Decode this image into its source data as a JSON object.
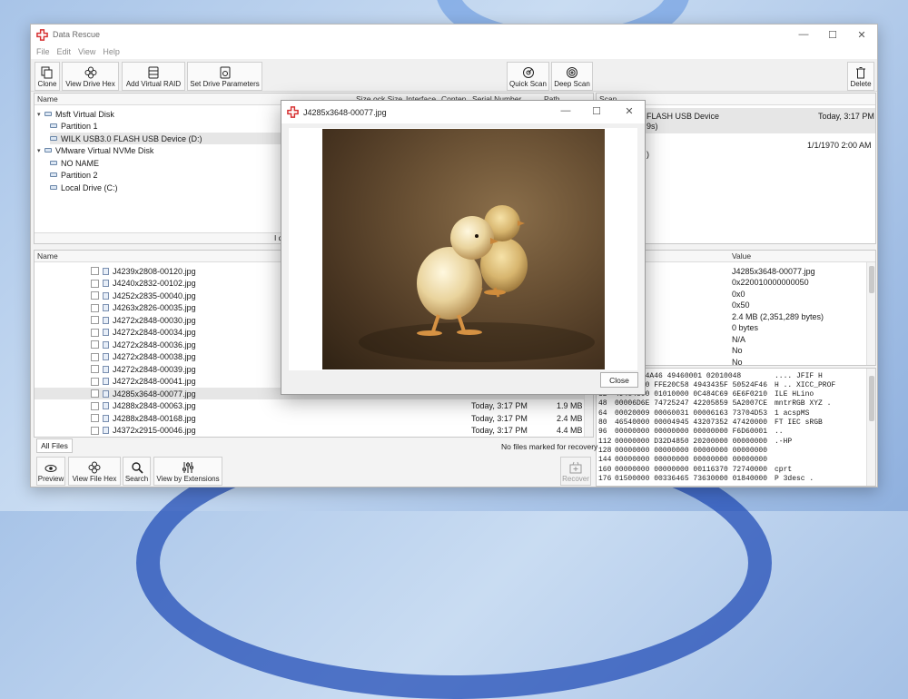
{
  "app": {
    "title": "Data Rescue"
  },
  "menu": [
    "File",
    "Edit",
    "View",
    "Help"
  ],
  "toolbar": {
    "clone": "Clone",
    "view_drive_hex": "View Drive Hex",
    "add_virtual_raid": "Add Virtual RAID",
    "set_drive_parameters": "Set Drive Parameters",
    "quick_scan": "Quick Scan",
    "deep_scan": "Deep Scan",
    "delete": "Delete"
  },
  "drives": {
    "headers": {
      "name": "Name",
      "size": "Size",
      "block_size": "ock Size",
      "interface": "Interface",
      "content": "Conten",
      "serial": "Serial Number",
      "path": "Path"
    },
    "items": [
      {
        "label": "Msft Virtual Disk"
      },
      {
        "label": "Partition 1"
      },
      {
        "label": "WILK USB3.0 FLASH USB Device (D:)"
      },
      {
        "label": "VMware Virtual NVMe Disk"
      },
      {
        "label": "NO NAME"
      },
      {
        "label": "Partition 2"
      },
      {
        "label": "Local Drive (C:)"
      }
    ],
    "bottom_fragment": "I d"
  },
  "scans": {
    "header": "Scan",
    "rows": [
      {
        "name": "FLASH USB Device",
        "sub": "9s)",
        "date": "Today, 3:17 PM"
      },
      {
        "name": "",
        "sub": ")",
        "date": "1/1/1970 2:00 AM"
      }
    ]
  },
  "files": {
    "header_name": "Name",
    "items": [
      {
        "name": "J4239x2808-00120.jpg",
        "date": "",
        "size": ""
      },
      {
        "name": "J4240x2832-00102.jpg",
        "date": "",
        "size": ""
      },
      {
        "name": "J4252x2835-00040.jpg",
        "date": "",
        "size": ""
      },
      {
        "name": "J4263x2826-00035.jpg",
        "date": "",
        "size": ""
      },
      {
        "name": "J4272x2848-00030.jpg",
        "date": "",
        "size": ""
      },
      {
        "name": "J4272x2848-00034.jpg",
        "date": "",
        "size": ""
      },
      {
        "name": "J4272x2848-00036.jpg",
        "date": "",
        "size": ""
      },
      {
        "name": "J4272x2848-00038.jpg",
        "date": "",
        "size": ""
      },
      {
        "name": "J4272x2848-00039.jpg",
        "date": "",
        "size": ""
      },
      {
        "name": "J4272x2848-00041.jpg",
        "date": "",
        "size": ""
      },
      {
        "name": "J4285x3648-00077.jpg",
        "date": "",
        "size": ""
      },
      {
        "name": "J4288x2848-00063.jpg",
        "date": "Today, 3:17 PM",
        "size": "1.9 MB"
      },
      {
        "name": "J4288x2848-00168.jpg",
        "date": "Today, 3:17 PM",
        "size": "2.4 MB"
      },
      {
        "name": "J4372x2915-00046.jpg",
        "date": "Today, 3:17 PM",
        "size": "4.4 MB"
      }
    ],
    "tab_all_files": "All Files",
    "status": "No files marked for recovery"
  },
  "bottom_toolbar": {
    "preview": "Preview",
    "view_file_hex": "View File Hex",
    "search": "Search",
    "view_by_extensions": "View by Extensions",
    "recover": "Recover"
  },
  "properties": {
    "header_value": "Value",
    "values": [
      "J4285x3648-00077.jpg",
      "0x220010000000050",
      "0x0",
      "0x50",
      "2.4 MB (2,351,289 bytes)",
      "0 bytes",
      "N/A",
      "No",
      "No"
    ]
  },
  "hexdump": {
    "rows": [
      {
        "off": "",
        "hex": "20 00104A46 49460001 02010048",
        "ascii": "....  JFIF    H"
      },
      {
        "off": "16",
        "hex": "00480000 FFE20C58 4943435F 50524F46",
        "ascii": "H  .. XICC_PROF"
      },
      {
        "off": "32",
        "hex": "494C4500 01010000 0C484C69 6E6F0210",
        "ascii": "ILE      HLino"
      },
      {
        "off": "48",
        "hex": "00006D6E 74725247 42205859 5A2007CE",
        "ascii": "mntrRGB XYZ  ."
      },
      {
        "off": "64",
        "hex": "00020009 00060031 00006163 73704D53",
        "ascii": "1  acspMS"
      },
      {
        "off": "80",
        "hex": "46540000 00004945 43207352 47420000",
        "ascii": "FT    IEC sRGB"
      },
      {
        "off": "96",
        "hex": "00000000 00000000 00000000 F6D60001",
        "ascii": ".."
      },
      {
        "off": "112",
        "hex": "00000000 D32D4850 20200000 00000000",
        "ascii": ".-HP"
      },
      {
        "off": "128",
        "hex": "00000000 00000000 00000000 00000000",
        "ascii": ""
      },
      {
        "off": "144",
        "hex": "00000000 00000000 00000000 00000000",
        "ascii": ""
      },
      {
        "off": "160",
        "hex": "00000000 00000000 00116370 72740000",
        "ascii": "cprt"
      },
      {
        "off": "176",
        "hex": "01500000 00336465 73630000 01840000",
        "ascii": "P    3desc  ."
      }
    ]
  },
  "preview_dialog": {
    "title": "J4285x3648-00077.jpg",
    "close_label": "Close"
  },
  "colors": {
    "accent": "#d63031",
    "selection": "#e6e6e6",
    "window_bg": "#f3f3f3"
  }
}
